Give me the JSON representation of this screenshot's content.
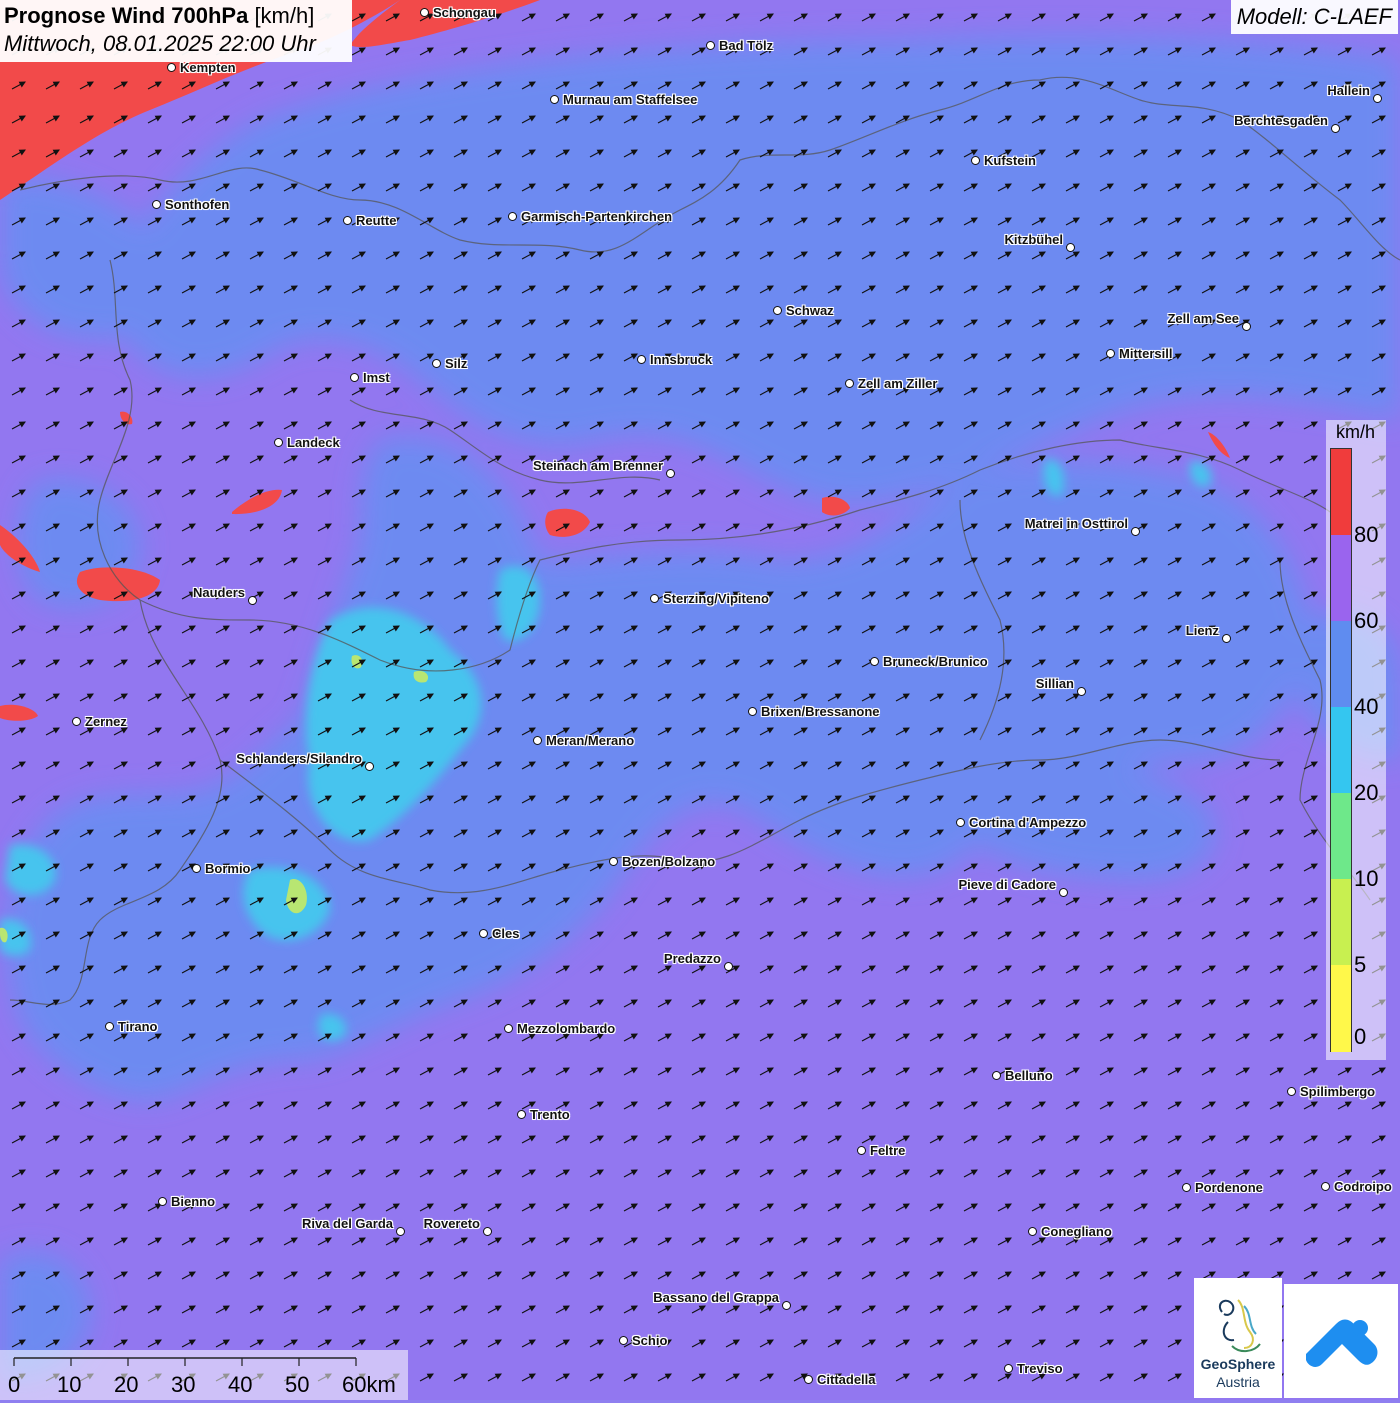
{
  "title": {
    "main": "Prognose Wind 700hPa",
    "unit": "[km/h]",
    "datetime": "Mittwoch, 08.01.2025 22:00 Uhr"
  },
  "model": "Modell: C-LAEF",
  "legend": {
    "unit": "km/h",
    "ticks": [
      "80",
      "60",
      "40",
      "20",
      "10",
      "5",
      "0"
    ],
    "colors": [
      "#f03c3c",
      "#9a64ee",
      "#5f8cf0",
      "#34c6f0",
      "#6ee88a",
      "#c8f050",
      "#fff84a"
    ]
  },
  "scale_bar": {
    "labels": [
      "0",
      "10",
      "20",
      "30",
      "40",
      "50",
      "60km"
    ]
  },
  "logos": {
    "geosphere_line1": "GeoSphere",
    "geosphere_line2": "Austria"
  },
  "field_colors": {
    "purple": "#9277f0",
    "blue": "#6c8cf2",
    "cyan": "#44c8ee",
    "red": "#f24a4a",
    "green": "#bfe86a"
  },
  "wind_direction": "south-west to north-east",
  "cities": [
    {
      "name": "Schongau"
    },
    {
      "name": "Bad Tölz"
    },
    {
      "name": "Kempten"
    },
    {
      "name": "Murnau am Staffelsee"
    },
    {
      "name": "Hallein"
    },
    {
      "name": "Berchtesgaden"
    },
    {
      "name": "Kufstein"
    },
    {
      "name": "Sonthofen"
    },
    {
      "name": "Reutte"
    },
    {
      "name": "Garmisch-Partenkirchen"
    },
    {
      "name": "Kitzbühel"
    },
    {
      "name": "Schwaz"
    },
    {
      "name": "Zell am See"
    },
    {
      "name": "Mittersill"
    },
    {
      "name": "Imst"
    },
    {
      "name": "Silz"
    },
    {
      "name": "Innsbruck"
    },
    {
      "name": "Zell am Ziller"
    },
    {
      "name": "Landeck"
    },
    {
      "name": "Steinach am Brenner"
    },
    {
      "name": "Matrei in Osttirol"
    },
    {
      "name": "Nauders"
    },
    {
      "name": "Sterzing/Vipiteno"
    },
    {
      "name": "Lienz"
    },
    {
      "name": "Bruneck/Brunico"
    },
    {
      "name": "Sillian"
    },
    {
      "name": "Zernez"
    },
    {
      "name": "Brixen/Bressanone"
    },
    {
      "name": "Meran/Merano"
    },
    {
      "name": "Schlanders/Silandro"
    },
    {
      "name": "Cortina d'Ampezzo"
    },
    {
      "name": "Bormio"
    },
    {
      "name": "Bozen/Bolzano"
    },
    {
      "name": "Pieve di Cadore"
    },
    {
      "name": "Cles"
    },
    {
      "name": "Predazzo"
    },
    {
      "name": "Tirano"
    },
    {
      "name": "Mezzolombardo"
    },
    {
      "name": "Belluno"
    },
    {
      "name": "Spilimbergo"
    },
    {
      "name": "Trento"
    },
    {
      "name": "Feltre"
    },
    {
      "name": "Pordenone"
    },
    {
      "name": "Codroipo"
    },
    {
      "name": "Bienno"
    },
    {
      "name": "Riva del Garda"
    },
    {
      "name": "Rovereto"
    },
    {
      "name": "Conegliano"
    },
    {
      "name": "Bassano del Grappa"
    },
    {
      "name": "Schio"
    },
    {
      "name": "Treviso"
    },
    {
      "name": "Cittadella"
    }
  ]
}
